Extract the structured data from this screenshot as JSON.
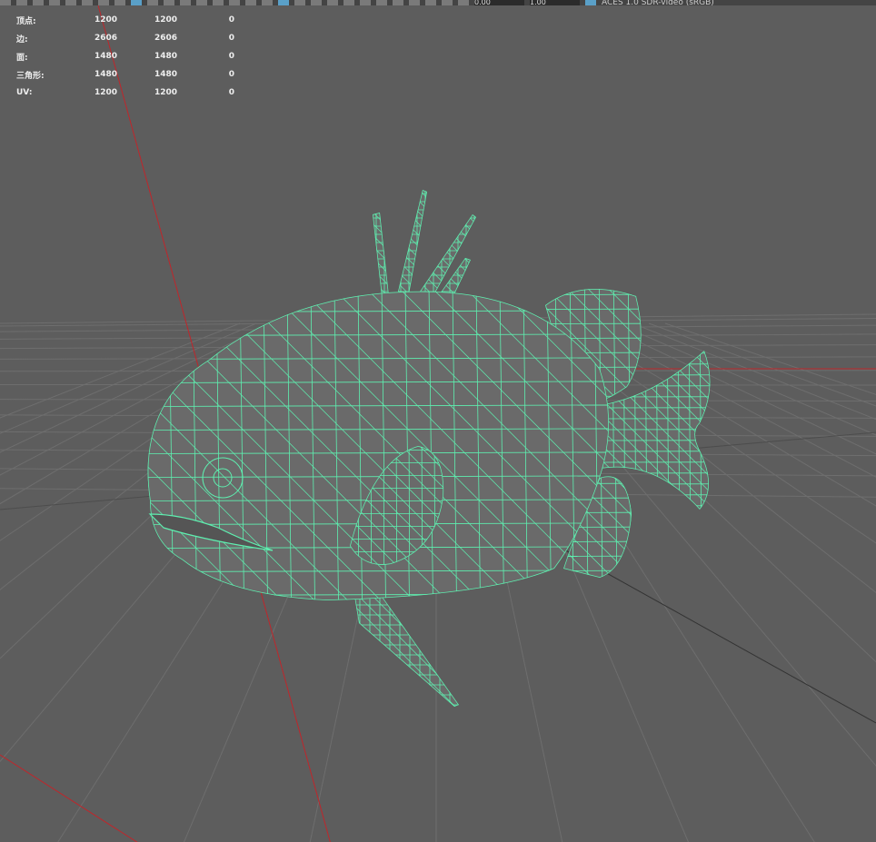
{
  "toolbar": {
    "field1": "0.00",
    "field2": "1.00",
    "color_space": "ACES 1.0 SDR-video (sRGB)"
  },
  "stats": [
    {
      "label": "顶点:",
      "a": "1200",
      "b": "1200",
      "c": "0"
    },
    {
      "label": "边:",
      "a": "2606",
      "b": "2606",
      "c": "0"
    },
    {
      "label": "面:",
      "a": "1480",
      "b": "1480",
      "c": "0"
    },
    {
      "label": "三角形:",
      "a": "1480",
      "b": "1480",
      "c": "0"
    },
    {
      "label": "UV:",
      "a": "1200",
      "b": "1200",
      "c": "0"
    }
  ],
  "colors": {
    "background": "#5d5d5d",
    "wireframe": "#5ef0b0",
    "axis_x": "#c0262b",
    "grid": "#6e6e6e"
  }
}
